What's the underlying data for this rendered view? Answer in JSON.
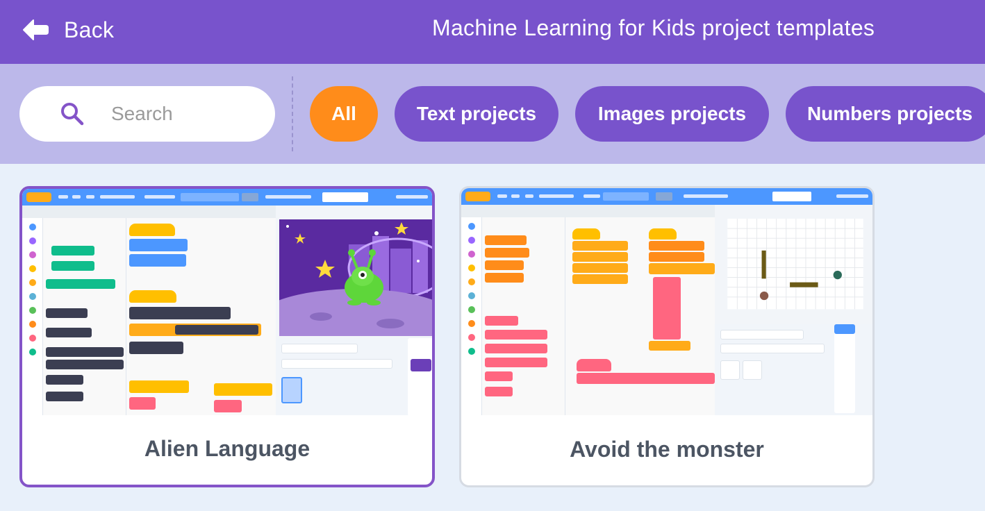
{
  "header": {
    "back_label": "Back",
    "title": "Machine Learning for Kids project templates"
  },
  "filters": {
    "search_placeholder": "Search",
    "chips": [
      {
        "label": "All",
        "active": true,
        "color": "#ff8c1a"
      },
      {
        "label": "Text projects",
        "active": false,
        "color": "#7853cc"
      },
      {
        "label": "Images projects",
        "active": false,
        "color": "#7853cc"
      },
      {
        "label": "Numbers projects",
        "active": false,
        "color": "#7853cc"
      }
    ]
  },
  "projects": [
    {
      "title": "Alien Language",
      "selected": true
    },
    {
      "title": "Avoid the monster",
      "selected": false
    }
  ],
  "colors": {
    "header_bg": "#7853cc",
    "filterbar_bg": "#bcb8ea",
    "page_bg": "#e8f0fa",
    "active_chip": "#ff8c1a",
    "chip": "#7853cc",
    "selected_border": "#8454c8",
    "card_title": "#4c5563"
  }
}
